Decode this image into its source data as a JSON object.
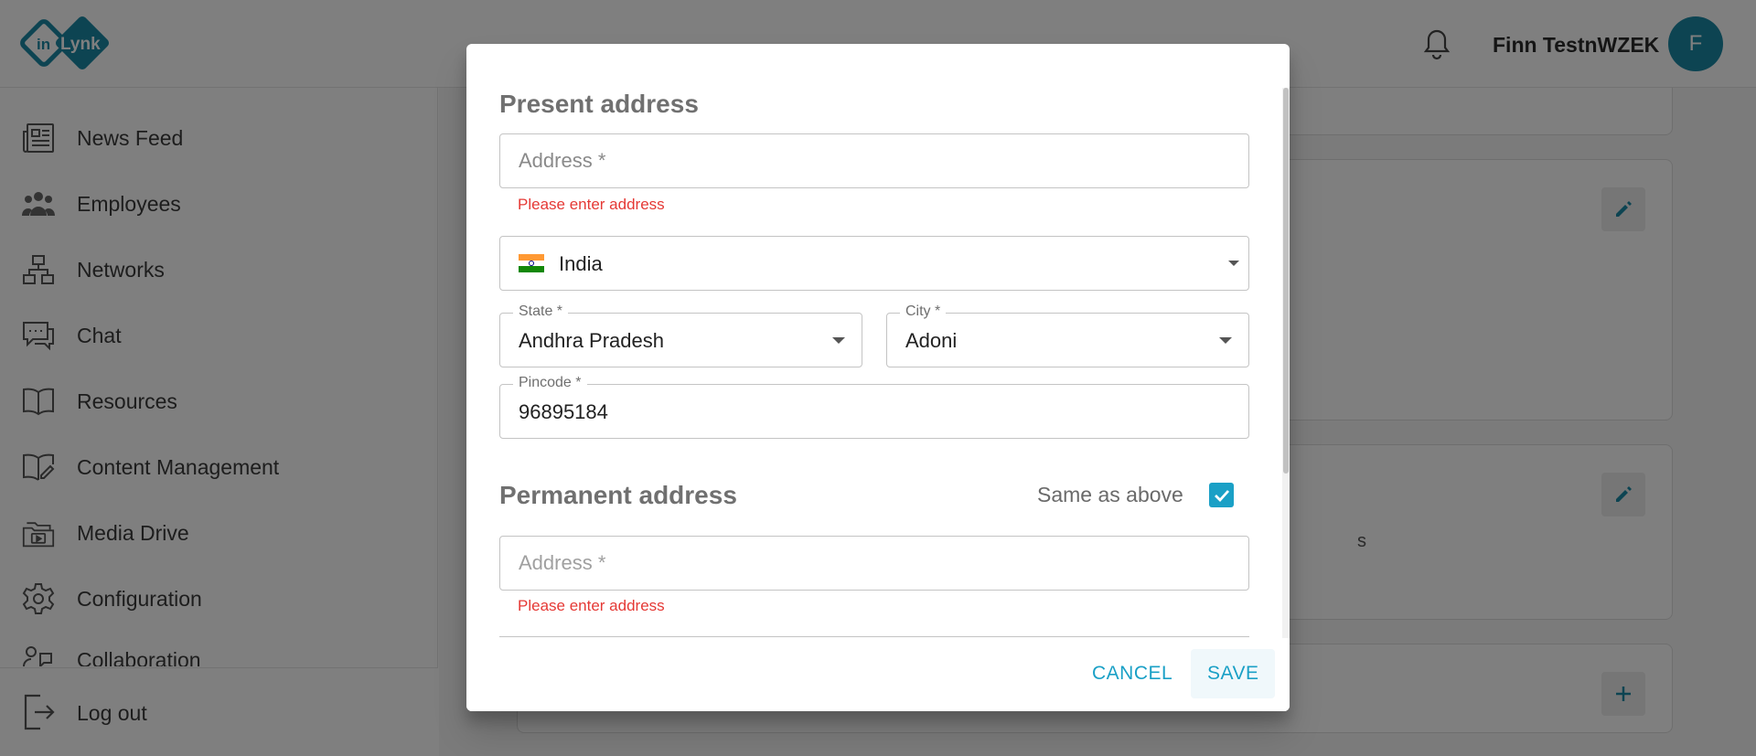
{
  "app": {
    "logo_text_in": "in",
    "logo_text_lynk": "Lynk"
  },
  "colors": {
    "accent": "#1aa0c6",
    "error": "#e53935",
    "avatar_bg": "#1a88a5"
  },
  "header": {
    "user_name": "Finn TestnWZEK",
    "avatar_initial": "F",
    "bell_icon": "bell-icon"
  },
  "sidebar": {
    "items": [
      {
        "label": "News Feed",
        "icon": "newspaper-icon"
      },
      {
        "label": "Employees",
        "icon": "people-icon"
      },
      {
        "label": "Networks",
        "icon": "network-icon"
      },
      {
        "label": "Chat",
        "icon": "chat-icon"
      },
      {
        "label": "Resources",
        "icon": "book-icon"
      },
      {
        "label": "Content Management",
        "icon": "book-edit-icon"
      },
      {
        "label": "Media Drive",
        "icon": "folder-media-icon"
      },
      {
        "label": "Configuration",
        "icon": "gear-icon"
      },
      {
        "label": "Collaboration",
        "icon": "collaboration-icon"
      }
    ],
    "logout_label": "Log out"
  },
  "background_partial_text": "s",
  "dialog": {
    "present": {
      "title": "Present address",
      "address_placeholder": "Address *",
      "address_error": "Please enter address",
      "country_value": "India",
      "state_label": "State *",
      "state_value": "Andhra Pradesh",
      "city_label": "City *",
      "city_value": "Adoni",
      "pincode_label": "Pincode *",
      "pincode_value": "96895184"
    },
    "permanent": {
      "title": "Permanent address",
      "same_as_above_label": "Same as above",
      "same_as_above_checked": true,
      "address_placeholder": "Address *",
      "address_error": "Please enter address"
    },
    "actions": {
      "cancel": "CANCEL",
      "save": "SAVE"
    }
  }
}
